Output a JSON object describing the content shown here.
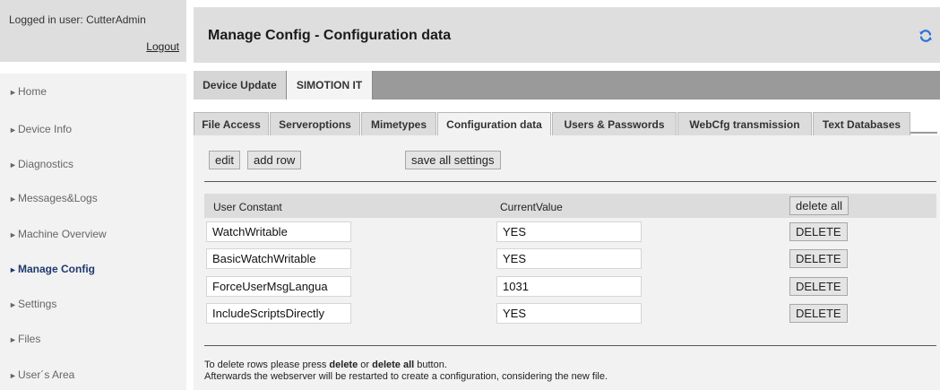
{
  "sidebar": {
    "login_text": "Logged in user: CutterAdmin",
    "logout_label": "Logout",
    "nav": [
      {
        "label": "Home"
      },
      {
        "label": "Device Info"
      },
      {
        "label": "Diagnostics"
      },
      {
        "label": "Messages&Logs"
      },
      {
        "label": "Machine Overview"
      },
      {
        "label": "Manage Config"
      },
      {
        "label": "Settings"
      },
      {
        "label": "Files"
      },
      {
        "label": "User´s Area"
      }
    ],
    "nav_arrow": "►"
  },
  "header": {
    "title": "Manage Config - Configuration data",
    "refresh_icon": "refresh-icon"
  },
  "top_tabs": [
    {
      "label": "Device Update"
    },
    {
      "label": "SIMOTION IT"
    }
  ],
  "sub_tabs": [
    {
      "label": "File Access"
    },
    {
      "label": "Serveroptions"
    },
    {
      "label": "Mimetypes"
    },
    {
      "label": "Configuration data"
    },
    {
      "label": "Users & Passwords"
    },
    {
      "label": "WebCfg transmission"
    },
    {
      "label": "Text Databases"
    }
  ],
  "toolbar": {
    "edit_label": "edit",
    "add_row_label": "add row",
    "save_all_label": "save all settings"
  },
  "table": {
    "col_constant": "User Constant",
    "col_value": "CurrentValue",
    "delete_all_label": "delete all",
    "delete_label": "DELETE",
    "rows": [
      {
        "constant": "WatchWritable",
        "value": "YES"
      },
      {
        "constant": "BasicWatchWritable",
        "value": "YES"
      },
      {
        "constant": "ForceUserMsgLangua",
        "value": "1031"
      },
      {
        "constant": "IncludeScriptsDirectly",
        "value": "YES"
      }
    ]
  },
  "help": {
    "line1_a": "To delete rows please press ",
    "line1_b": "delete",
    "line1_c": " or ",
    "line1_d": "delete all",
    "line1_e": " button.",
    "line2": "Afterwards the webserver will be restarted to create a configuration, considering the new file."
  },
  "colors": {
    "active_nav": "#1e3a6e",
    "refresh_icon": "#2a6fd6"
  }
}
